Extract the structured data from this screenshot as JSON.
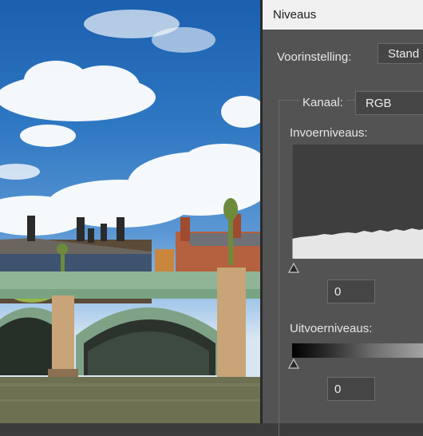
{
  "dialog": {
    "title": "Niveaus",
    "preset_label": "Voorinstelling:",
    "preset_value": "Stand",
    "channel_label": "Kanaal:",
    "channel_value": "RGB",
    "input_levels_label": "Invoerniveaus:",
    "input_black_value": "0",
    "output_levels_label": "Uitvoerniveaus:",
    "output_black_value": "0"
  },
  "colors": {
    "dialog_bg": "#535353",
    "titlebar_bg": "#f0f0f0",
    "sky_blue": "#2f78c2",
    "bridge_green": "#8fb596"
  }
}
